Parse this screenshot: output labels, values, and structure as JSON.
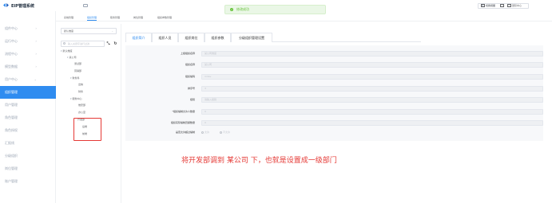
{
  "app": {
    "title": "EIP管理系统"
  },
  "sidebar": {
    "items": [
      {
        "label": "组件中心",
        "expandable": true
      },
      {
        "label": "运行中心",
        "expandable": true
      },
      {
        "label": "流程中心",
        "expandable": true
      },
      {
        "label": "模型数据",
        "expandable": true
      },
      {
        "label": "用户中心",
        "expandable": true
      },
      {
        "label": "组织管理",
        "expandable": false,
        "active": true
      },
      {
        "label": "用户管理",
        "expandable": false
      },
      {
        "label": "角色管理",
        "expandable": false
      },
      {
        "label": "角色授权",
        "expandable": false
      },
      {
        "label": "汇报线",
        "expandable": false
      },
      {
        "label": "分级组织",
        "expandable": false
      },
      {
        "label": "岗位管理",
        "expandable": false
      },
      {
        "label": "账户管理",
        "expandable": false
      }
    ]
  },
  "toast": {
    "message": "修改成功"
  },
  "topbar": {
    "search_placeholder": "搜索菜单",
    "tools": [
      "切换视图",
      "",
      "国际中心"
    ]
  },
  "tabs": [
    "系统管理",
    "组织管理",
    "职务管理",
    "岗位管理",
    "组织参数管理"
  ],
  "tree": {
    "selected_dimension": "默认维度",
    "filter_placeholder": "输入关键字进行过滤",
    "nodes": [
      {
        "label": "默认维度",
        "expanded": true
      },
      {
        "label": "某公司",
        "expanded": true
      },
      {
        "label": "测试部",
        "expanded": false
      },
      {
        "label": "营销部",
        "expanded": false
      },
      {
        "label": "财务科",
        "expanded": true
      },
      {
        "label": "出纳",
        "expanded": false
      },
      {
        "label": "财务",
        "expanded": false
      },
      {
        "label": "服务中心",
        "expanded": true
      },
      {
        "label": "维安部",
        "expanded": false
      },
      {
        "label": "办公室",
        "expanded": false
      },
      {
        "label": "开发部",
        "expanded": true
      },
      {
        "label": "后端",
        "expanded": false
      },
      {
        "label": "前端",
        "expanded": false
      }
    ]
  },
  "content_tabs": [
    "组织简介",
    "组织人员",
    "组织岗位",
    "组织参数",
    "分级组织管理设置"
  ],
  "form": {
    "rows": [
      {
        "label": "上级组织名称",
        "value": "某公司维度"
      },
      {
        "label": "组织名称",
        "value": "某公司"
      },
      {
        "label": "组织编码",
        "value": "mdev"
      },
      {
        "label": "排序号",
        "value": "3"
      },
      {
        "label": "级别",
        "value": "请输入级别"
      },
      {
        "label": "*组织编制允许人数量",
        "value": "0"
      },
      {
        "label": "组织实际编制员额数量",
        "value": "0"
      }
    ],
    "radio_row": {
      "label": "是否允许超过编制",
      "options": [
        "允许",
        "不允许"
      ]
    }
  },
  "annotation": {
    "text": "将开发部调到 某公司 下，也就是设置成一级部门"
  },
  "colors": {
    "accent": "#2f8cf0",
    "success": "#67c23a",
    "annotation": "#e53935"
  }
}
